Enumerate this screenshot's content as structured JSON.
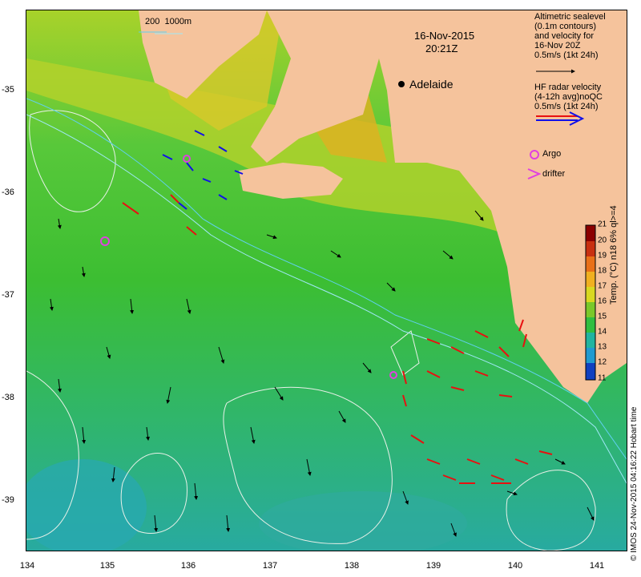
{
  "date_label": "16-Nov-2015",
  "time_label": "20:21Z",
  "city": {
    "name": "Adelaide"
  },
  "depth_contours_label": "200  1000m",
  "altimetry_legend": [
    "Altimetric sealevel",
    "(0.1m contours)",
    "and velocity for",
    "16-Nov 20Z",
    "0.5m/s (1kt 24h)"
  ],
  "radar_legend": [
    "HF radar velocity",
    "(4-12h avg)noQC",
    "0.5m/s (1kt 24h)"
  ],
  "argo_label": "Argo",
  "drifter_label": "drifter",
  "colorbar": {
    "title": "Temp. (°C) n18 6% ql>=4",
    "ticks": [
      "21",
      "20",
      "19",
      "18",
      "17",
      "16",
      "15",
      "14",
      "13",
      "12",
      "11"
    ]
  },
  "x_ticks": [
    "134",
    "135",
    "136",
    "137",
    "138",
    "139",
    "140",
    "141"
  ],
  "y_ticks": [
    "-35",
    "-36",
    "-37",
    "-38",
    "-39"
  ],
  "copyright": "© IMOS 24-Nov-2015 04:16:22 Hobart time",
  "colors": {
    "land": "#f5c39c",
    "ocean_warm": "#e0c020",
    "ocean_mid": "#3cbe32",
    "ocean_cool": "#28b4a0",
    "radar_arrow": "#e81010",
    "radar_arrow_alt": "#1010e8",
    "argo": "#e040e0"
  }
}
